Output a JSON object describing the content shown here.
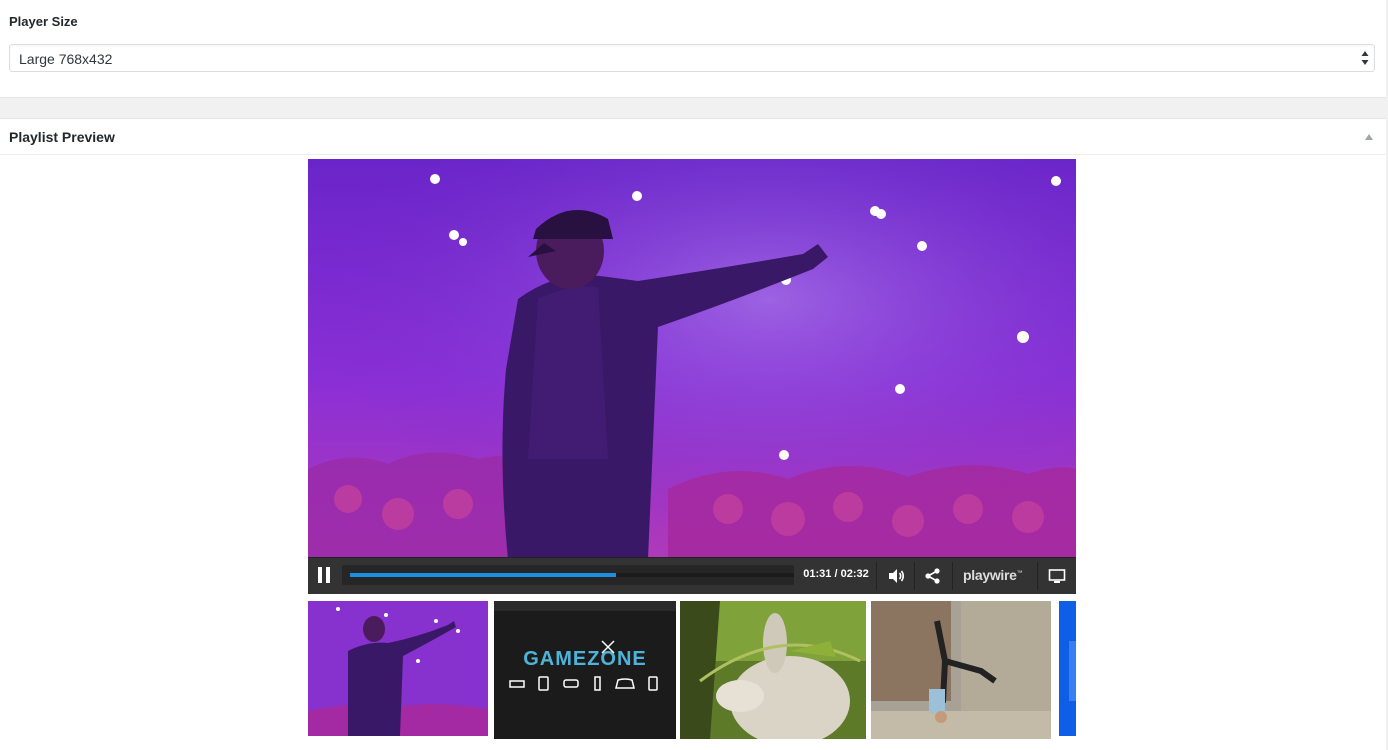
{
  "player_size": {
    "label": "Player Size",
    "selected": "Large 768x432"
  },
  "playlist_preview": {
    "title": "Playlist Preview"
  },
  "player": {
    "current_time": "01:31",
    "duration": "02:32",
    "time_display": "01:31 / 02:32",
    "progress": 0.6,
    "brand": "playwire",
    "brand_mark": "™",
    "accent_color": "#1e8ee0"
  },
  "playlist": [
    {
      "id": "concert",
      "thumb": "concert performer on stage, purple light"
    },
    {
      "id": "gamezone",
      "thumb": "logo",
      "logo_text": "GAMEZONE"
    },
    {
      "id": "animation",
      "thumb": "animated character with bow"
    },
    {
      "id": "dance",
      "thumb": "break dancer in handstand"
    },
    {
      "id": "blue",
      "thumb": "blue partial thumbnail"
    }
  ],
  "icons": {
    "pause": "pause-icon",
    "volume": "volume-icon",
    "share": "share-icon",
    "screen": "screen-icon",
    "collapse": "triangle-up-icon",
    "select_arrows": "select-arrows-icon"
  }
}
